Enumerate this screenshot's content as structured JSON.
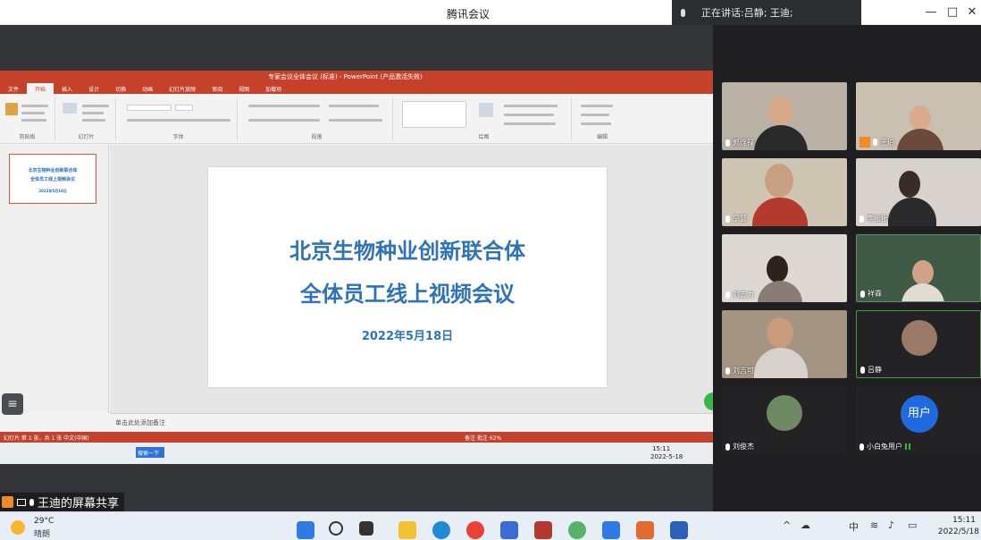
{
  "app": {
    "title": "腾讯会议",
    "speaking_label": "正在讲话:吕静; 王迪;"
  },
  "window_controls": {
    "minimize": "—",
    "maximize": "□",
    "close": "✕"
  },
  "ppt": {
    "title": "专家会议全体会议 (标准) - PowerPoint (产品激活失败)",
    "tabs": [
      "文件",
      "开始",
      "插入",
      "设计",
      "切换",
      "动画",
      "幻灯片放映",
      "审阅",
      "视图",
      "加载项"
    ],
    "ribbon_groups": [
      "剪贴板",
      "幻灯片",
      "字体",
      "段落",
      "绘图",
      "编辑"
    ],
    "thumb_lines": [
      "北京生物种业创新联合体",
      "全体员工线上视频会议",
      "2022年5月18日"
    ],
    "slide": {
      "line1": "北京生物种业创新联合体",
      "line2": "全体员工线上视频会议",
      "date": "2022年5月18日"
    },
    "notes_placeholder": "单击此处添加备注",
    "status_left": "幻灯片 第 1 张，共 1 张   中文(中国)",
    "status_right": "备注   批注   62%",
    "inner_clock_time": "15:11",
    "inner_clock_date": "2022-5-18",
    "inner_search": "搜索一下"
  },
  "share_label": "王迪的屏幕共享",
  "participants": [
    {
      "name": "郭连禄"
    },
    {
      "name": "王珀"
    },
    {
      "name": "宁慧"
    },
    {
      "name": "李振振"
    },
    {
      "name": "刘志力"
    },
    {
      "name": "祥霖"
    },
    {
      "name": "刘吉可"
    },
    {
      "name": "吕静"
    },
    {
      "name": "刘俊杰"
    },
    {
      "name": "小白兔用户"
    }
  ],
  "user_avatar_text": "用户",
  "taskbar": {
    "weather_temp": "29°C",
    "weather_desc": "晴朗",
    "time": "15:11",
    "date": "2022/5/18",
    "ime": "中"
  }
}
